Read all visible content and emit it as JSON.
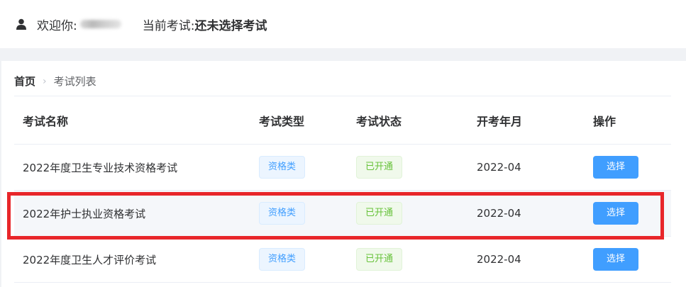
{
  "header": {
    "welcome_label": "欢迎你:",
    "current_exam_label": "当前考试:",
    "current_exam_value": "还未选择考试"
  },
  "breadcrumb": {
    "home": "首页",
    "separator": "›",
    "current": "考试列表"
  },
  "table": {
    "columns": [
      "考试名称",
      "考试类型",
      "考试状态",
      "开考年月",
      "操作"
    ],
    "rows": [
      {
        "name": "2022年度卫生专业技术资格考试",
        "type": "资格类",
        "status": "已开通",
        "month": "2022-04",
        "action": "选择"
      },
      {
        "name": "2022年护士执业资格考试",
        "type": "资格类",
        "status": "已开通",
        "month": "2022-04",
        "action": "选择"
      },
      {
        "name": "2022年度卫生人才评价考试",
        "type": "资格类",
        "status": "已开通",
        "month": "2022-04",
        "action": "选择"
      }
    ]
  },
  "colors": {
    "primary": "#409eff",
    "success": "#67c23a",
    "highlight_box": "#e8262a"
  }
}
